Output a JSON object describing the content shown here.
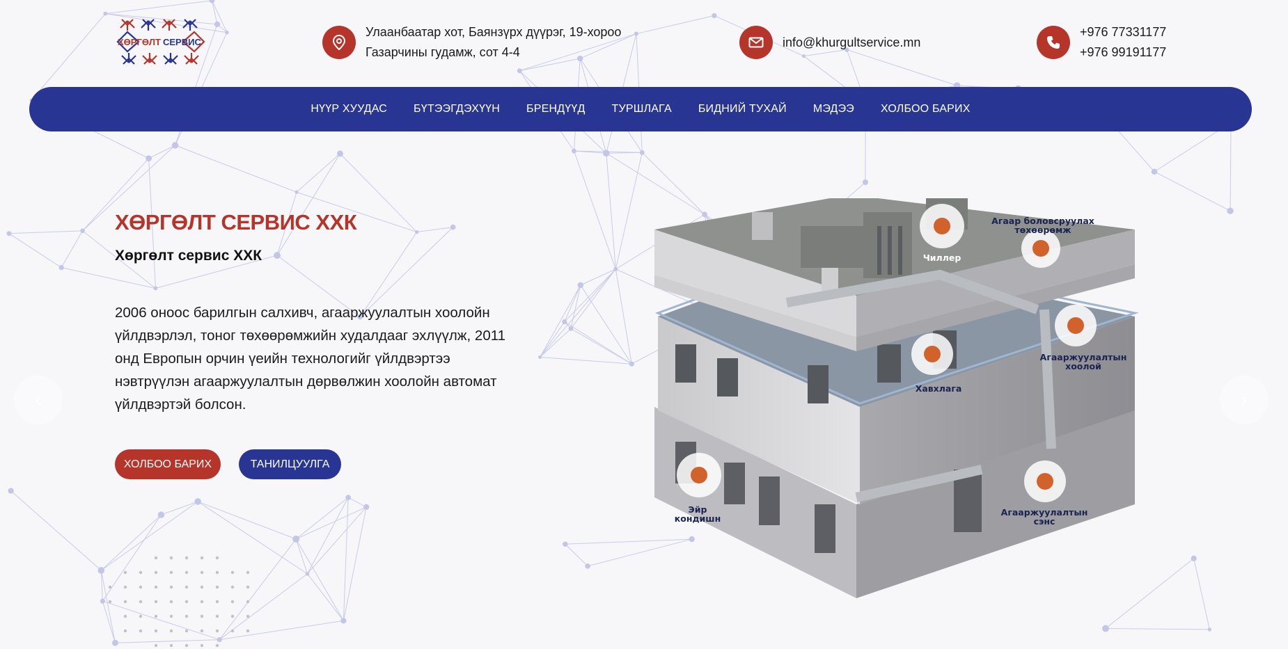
{
  "header": {
    "logo_text_left": "ХӨРГӨЛТ",
    "logo_text_right": "СЕРВИС",
    "address_line1": "Улаанбаатар хот, Баянзүрх дүүрэг, 19-хороо",
    "address_line2": "Газарчины гудамж, сот 4-4",
    "email": "info@khurgultservice.mn",
    "phone1": "+976 77331177",
    "phone2": "+976 99191177"
  },
  "nav": {
    "items": [
      {
        "label": "НҮҮР ХУУДАС"
      },
      {
        "label": "БҮТЭЭГДЭХҮҮН"
      },
      {
        "label": "БРЕНДҮҮД"
      },
      {
        "label": "ТУРШЛАГА"
      },
      {
        "label": "БИДНИЙ ТУХАЙ"
      },
      {
        "label": "МЭДЭЭ"
      },
      {
        "label": "ХОЛБОО БАРИХ"
      }
    ]
  },
  "hero": {
    "title": "ХӨРГӨЛТ СЕРВИС ХХК",
    "subtitle": "Хөргөлт сервис ХХК",
    "body": "2006 оноос барилгын салхивч, агааржуулалтын хоолойн үйлдвэрлэл, тоног төхөөрөмжийн худалдааг эхлүүлж, 2011 онд Европын орчин үеийн технологийг үйлдвэртээ нэвтрүүлэн агааржуулалтын дөрвөлжин хоолойн автомат үйлдвэртэй болсон.",
    "btn_contact": "ХОЛБОО БАРИХ",
    "btn_intro": "ТАНИЛЦУУЛГА"
  },
  "illustration": {
    "labels": {
      "chiller": "Чиллер",
      "ahu_1": "Агаар боловсруулах",
      "ahu_2": "төхөөрөмж",
      "duct_1": "Агааржуулалтын",
      "duct_2": "хоолой",
      "damper": "Хавхлага",
      "ac_1": "Эйр",
      "ac_2": "кондишн",
      "fan_1": "Агааржуулалтын",
      "fan_2": "сэнс"
    }
  },
  "colors": {
    "brand_red": "#b5352b",
    "brand_blue": "#283592",
    "hotspot_orange": "#d2622b"
  }
}
